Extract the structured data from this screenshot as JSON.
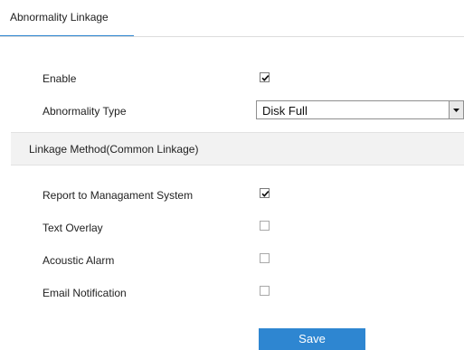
{
  "tabs": [
    {
      "label": "Abnormality Linkage",
      "active": true
    }
  ],
  "form": {
    "enable": {
      "label": "Enable",
      "checked": true
    },
    "abnormality_type": {
      "label": "Abnormality Type",
      "value": "Disk Full"
    }
  },
  "section": {
    "title": "Linkage Method(Common Linkage)"
  },
  "linkage_options": [
    {
      "label": "Report to Managament System",
      "checked": true
    },
    {
      "label": "Text Overlay",
      "checked": false
    },
    {
      "label": "Acoustic Alarm",
      "checked": false
    },
    {
      "label": "Email Notification",
      "checked": false
    }
  ],
  "actions": {
    "save_label": "Save"
  },
  "colors": {
    "accent": "#2e86d1",
    "section_bg": "#f2f2f2"
  },
  "icons": {
    "checkbox_checked": "checkmark-icon",
    "dropdown": "dropdown-arrow-icon"
  }
}
